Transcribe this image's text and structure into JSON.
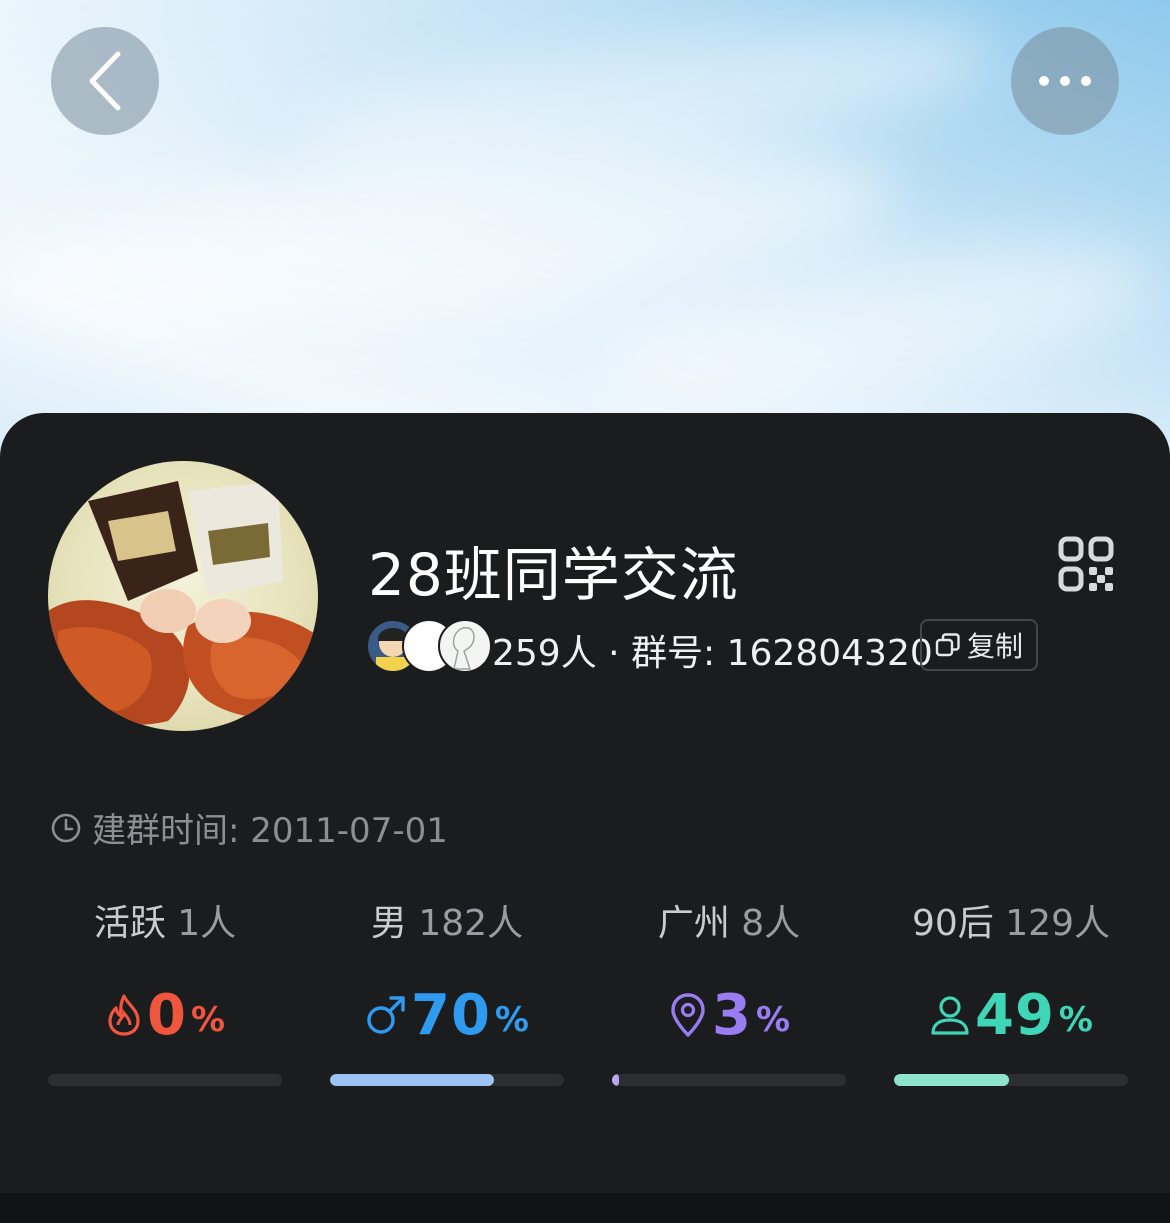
{
  "header": {
    "back_icon": "chevron-left-icon",
    "more_icon": "more-dots-icon"
  },
  "group": {
    "name": "28班同学交流",
    "member_line": "259人 · 群号: 162804320",
    "copy_label": "复制",
    "created_label": "建群时间: 2011-07-01"
  },
  "stats": [
    {
      "label": "活跃",
      "count": "1人",
      "value": "0",
      "unit": "%",
      "fill": 0.0,
      "color": "#f0553d",
      "icon": "flame-icon",
      "bar_color": "#f0553d"
    },
    {
      "label": "男",
      "count": "182人",
      "value": "70",
      "unit": "%",
      "fill": 0.7,
      "color": "#2f9bf0",
      "icon": "male-icon",
      "bar_color": "#9cc4f4"
    },
    {
      "label": "广州",
      "count": "8人",
      "value": "3",
      "unit": "%",
      "fill": 0.03,
      "color": "#9a7cf2",
      "icon": "location-pin-icon",
      "bar_color": "#b9a6f5"
    },
    {
      "label": "90后",
      "count": "129人",
      "value": "49",
      "unit": "%",
      "fill": 0.49,
      "color": "#3fd6b8",
      "icon": "person-icon",
      "bar_color": "#8ee3cf"
    }
  ]
}
